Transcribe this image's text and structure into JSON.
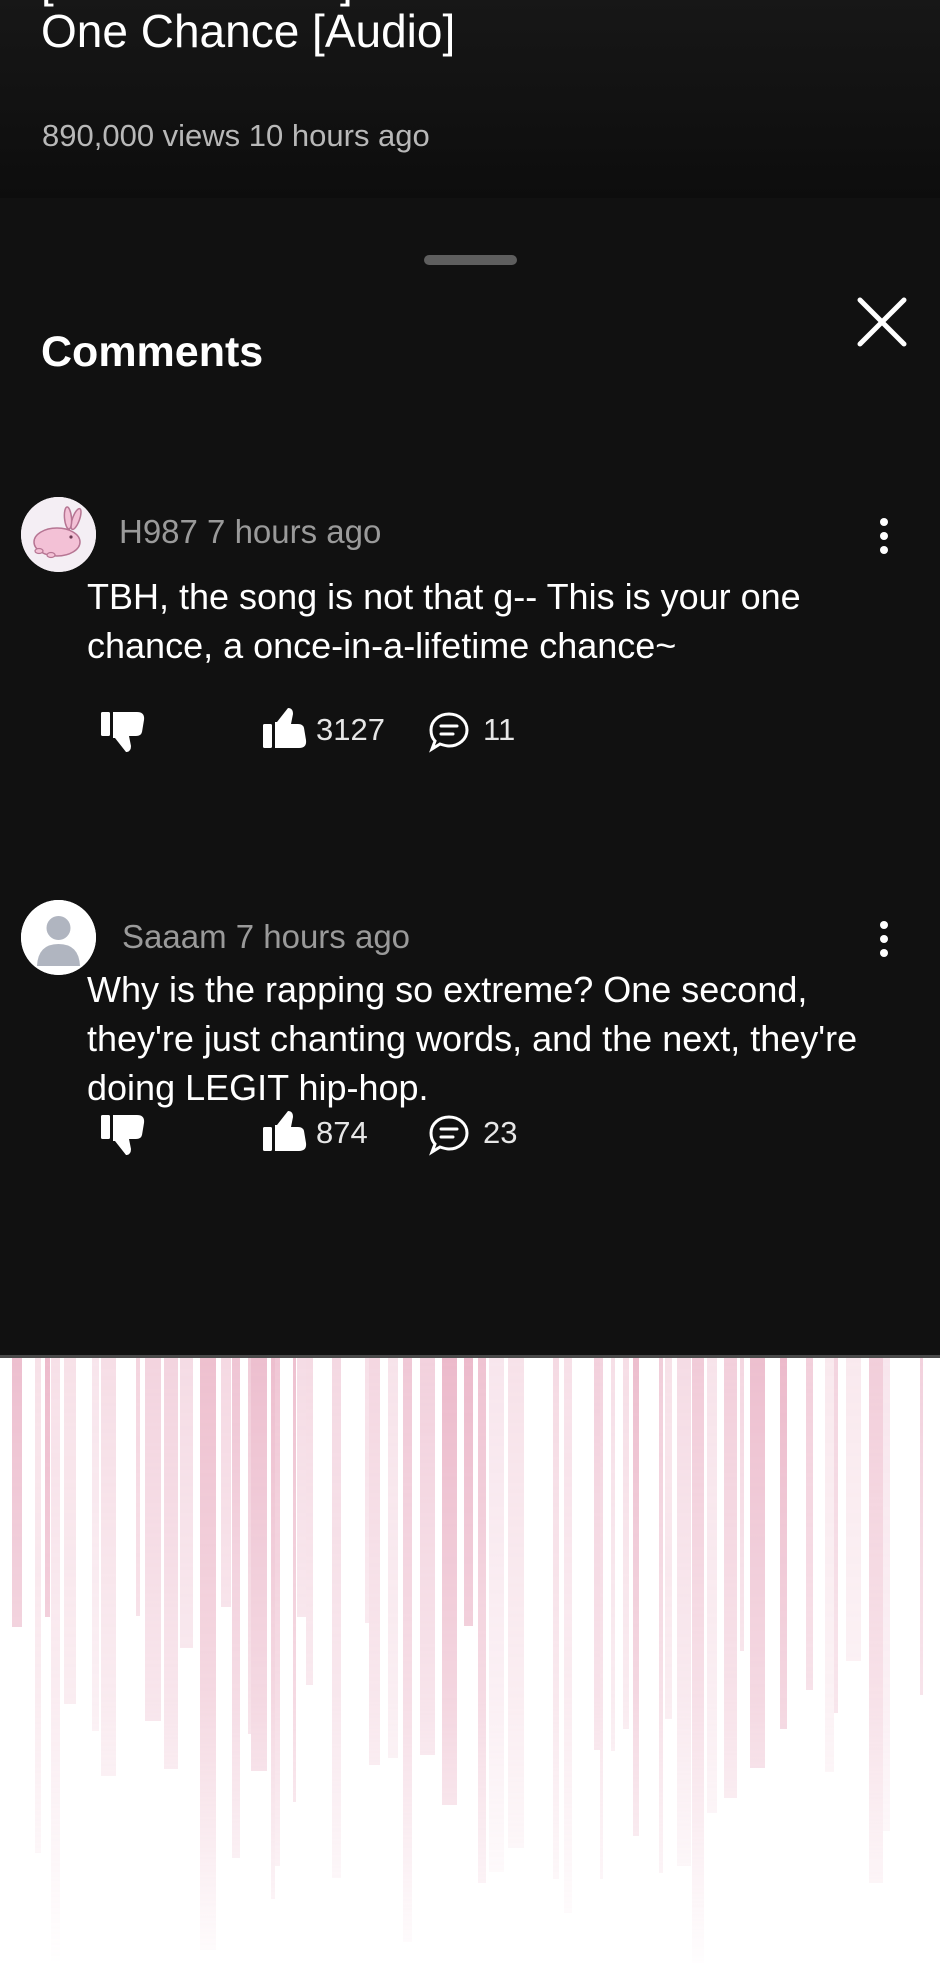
{
  "video": {
    "title": "[WPD Fancam] Reve Fancamok\nOne Chance [Audio]",
    "meta": "890,000 views 10 hours ago"
  },
  "sheet": {
    "title": "Comments",
    "close_icon": "close-icon",
    "handle_icon": "drag-handle"
  },
  "comments": [
    {
      "author": "H987",
      "time": "7 hours ago",
      "meta": "H987 7 hours ago",
      "text": "TBH, the song is not that g-- This is your one chance, a once-in-a-lifetime chance~",
      "likes": "3127",
      "replies": "11",
      "avatar": "pink-bunny-avatar"
    },
    {
      "author": "Saaam",
      "time": "7 hours ago",
      "meta": "Saaam 7 hours ago",
      "text": "Why is the rapping so extreme? One second, they're just chanting words, and the next, they're doing LEGIT hip-hop.",
      "likes": "874",
      "replies": "23",
      "avatar": "default-user-avatar"
    }
  ],
  "colors": {
    "sheet_bg": "#111111",
    "text_primary": "#ffffff",
    "text_secondary": "#9a9a9a",
    "banner_accent": "#e7a7bd"
  }
}
